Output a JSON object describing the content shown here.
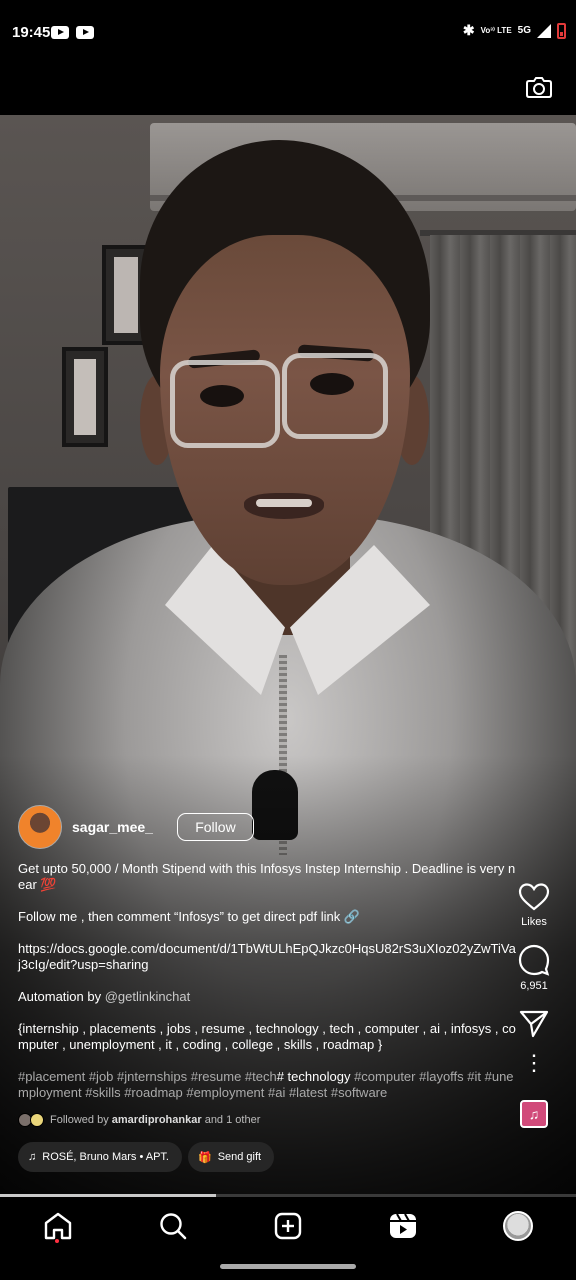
{
  "status_bar": {
    "time": "19:45",
    "volte_label": "Vo³⁾ LTE",
    "network": "5G",
    "icons": [
      "youtube-icon",
      "youtube-icon",
      "bluetooth-icon",
      "signal-icon",
      "battery-icon"
    ]
  },
  "top_bar": {
    "camera_icon": "camera-icon"
  },
  "reel": {
    "author": {
      "username": "sagar_mee_",
      "follow_label": "Follow"
    },
    "caption": {
      "line1": "Get upto 50,000 / Month Stipend with this Infosys Instep Internship . Deadline is very near 💯",
      "line2": "Follow me , then comment “Infosys” to get direct pdf link 🔗",
      "link": "https://docs.google.com/document/d/1TbWtULhEpQJkzc0HqsU82rS3uXIoz02yZwTiVaj3cIg/edit?usp=sharing",
      "automation_prefix": "Automation by ",
      "automation_handle": "@getlinkinchat",
      "keywords": "{internship , placements , jobs , resume , technology , tech , computer , ai , infosys , computer , unemployment , it , coding , college , skills , roadmap }",
      "tags_part1": "#placement #job #jnternships #resume #tech",
      "tags_white": "# technology",
      "tags_part2": " #computer #layoffs #it #unemployment #skills #roadmap #employment #ai #latest #software"
    },
    "followed_by": {
      "prefix": "Followed by ",
      "name": "amardiprohankar",
      "suffix": " and 1 other"
    },
    "audio_chip": "ROSÉ, Bruno Mars • APT.",
    "gift_chip": "Send gift",
    "actions": {
      "likes_label": "Likes",
      "comments_count": "6,951"
    },
    "progress": 0.375
  },
  "nav": {
    "items": [
      "home-icon",
      "search-icon",
      "create-icon",
      "reels-icon",
      "profile-avatar"
    ]
  },
  "colors": {
    "background": "#000000",
    "notification_dot": "#ff3040",
    "battery_low": "#e23a3a"
  }
}
